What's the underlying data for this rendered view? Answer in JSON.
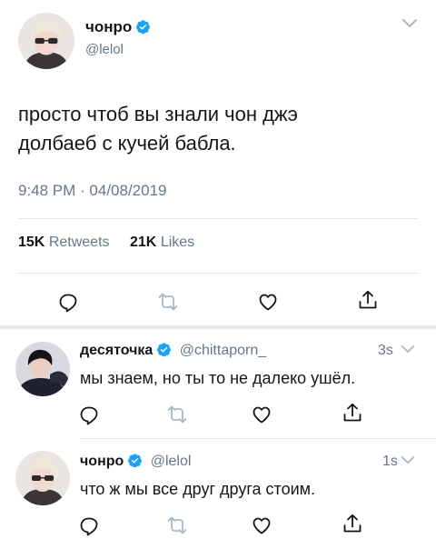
{
  "main_tweet": {
    "display_name": "чонро",
    "handle": "@lelol",
    "text_line1": "просто чтоб вы знали чон джэ",
    "text_line2": "долбаеб с кучей бабла.",
    "timestamp": "9:48 PM · 04/08/2019",
    "retweets_count": "15K",
    "retweets_label": "Retweets",
    "likes_count": "21K",
    "likes_label": "Likes"
  },
  "replies": [
    {
      "display_name": "десяточка",
      "handle": "@chittaporn_",
      "time": "3s",
      "text": "мы знаем, но ты то не далеко ушёл."
    },
    {
      "display_name": "чонро",
      "handle": "@lelol",
      "time": "1s",
      "text": "что ж мы все друг друга стоим."
    }
  ],
  "colors": {
    "verified": "#1da1f2",
    "secondary_text": "#657786",
    "divider": "#e1e8ed"
  },
  "icons": [
    "verified-badge-icon",
    "chevron-down-icon",
    "reply-icon",
    "retweet-icon",
    "like-icon",
    "share-icon"
  ]
}
